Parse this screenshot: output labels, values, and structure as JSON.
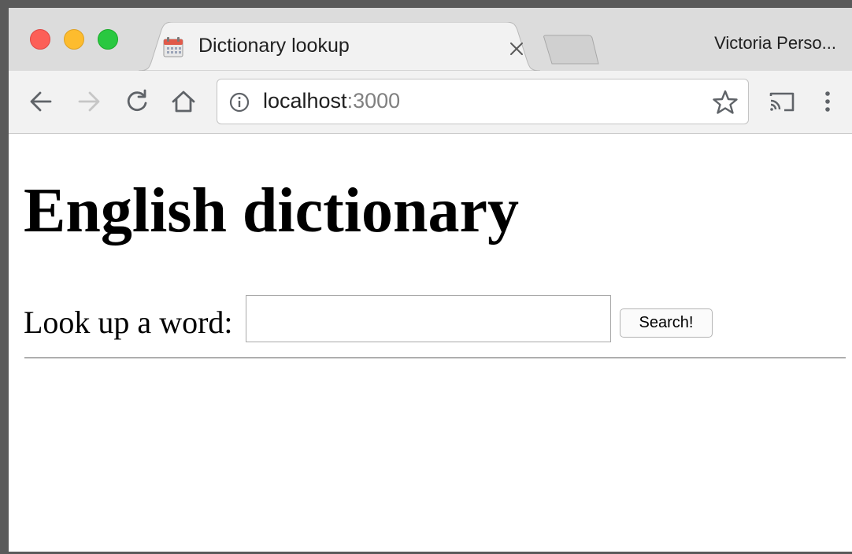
{
  "browser": {
    "tab_title": "Dictionary lookup",
    "profile_name": "Victoria Perso...",
    "url_host": "localhost",
    "url_port": ":3000"
  },
  "page": {
    "title": "English dictionary",
    "lookup_label": "Look up a word:",
    "search_input_value": "",
    "search_button_label": "Search!"
  },
  "icons": {
    "back": "back-arrow-icon",
    "forward": "forward-arrow-icon",
    "reload": "reload-icon",
    "home": "home-icon",
    "info": "info-icon",
    "bookmark": "star-icon",
    "cast": "cast-icon",
    "menu": "kebab-menu-icon",
    "favicon": "calendar-icon",
    "close_tab": "close-icon"
  },
  "colors": {
    "close": "#fc5f57",
    "minimize": "#fdbc2e",
    "maximize": "#29c840"
  }
}
